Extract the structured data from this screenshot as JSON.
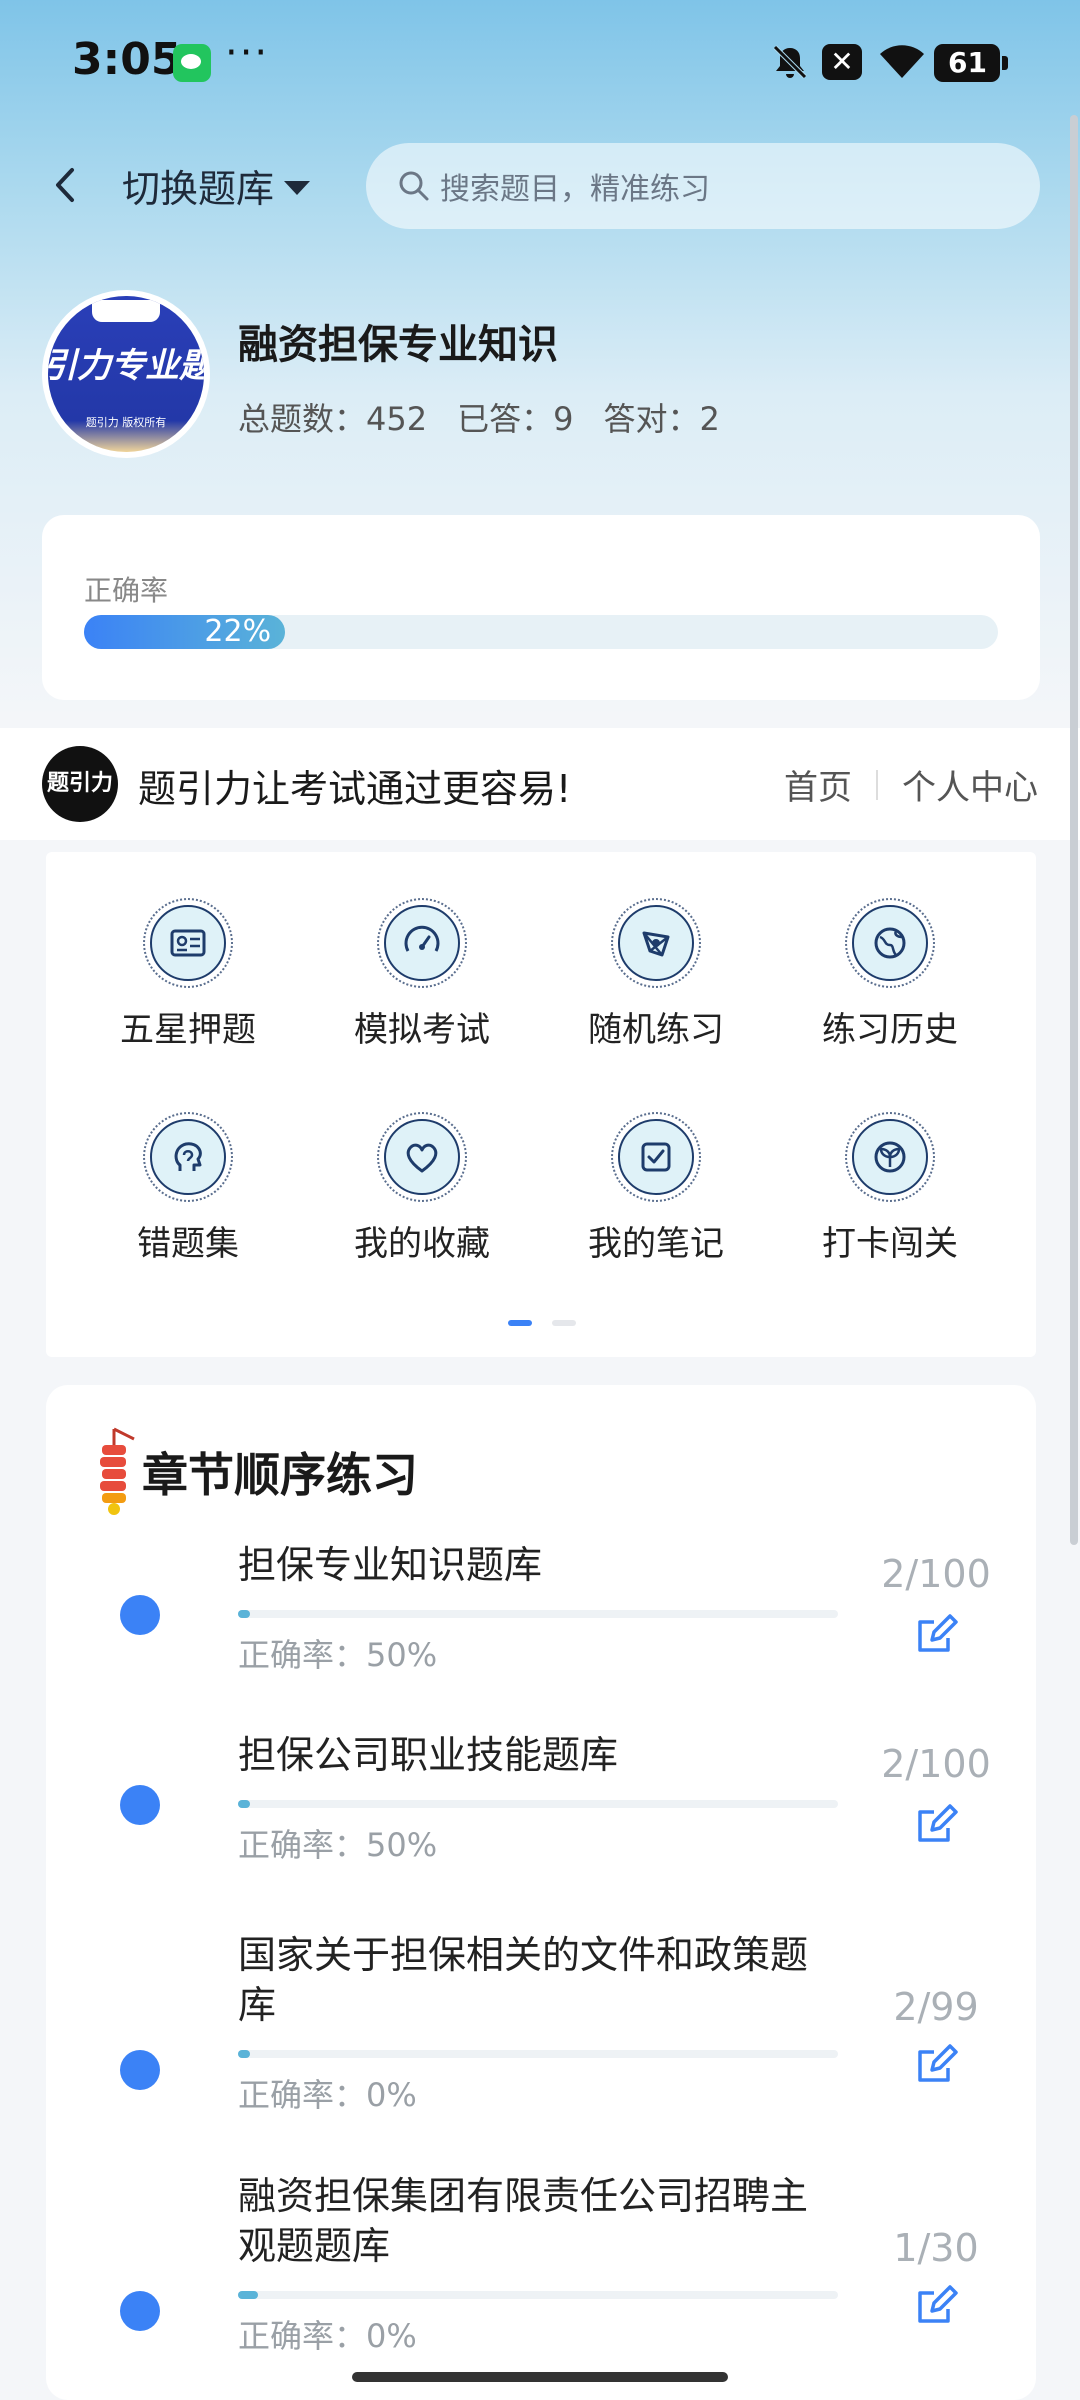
{
  "status": {
    "time": "3:05",
    "dots": "···",
    "x_label": "✕",
    "battery": "61"
  },
  "nav": {
    "switch_label": "切换题库",
    "search_placeholder": "搜索题目，精准练习"
  },
  "bank": {
    "logo_title": "引力专业题",
    "logo_sub": "题引力 版权所有",
    "name": "融资担保专业知识",
    "stats": {
      "total": "总题数：452",
      "answered": "已答：9",
      "correct": "答对：2"
    }
  },
  "accuracy": {
    "label": "正确率",
    "pct_text": "22%",
    "value": 0.22
  },
  "promo": {
    "logo_text": "题引力",
    "slogan": "题引力让考试通过更容易!",
    "home": "首页",
    "profile": "个人中心"
  },
  "grid": [
    {
      "label": "五星押题",
      "icon": "id-card-icon"
    },
    {
      "label": "模拟考试",
      "icon": "gauge-icon"
    },
    {
      "label": "随机练习",
      "icon": "network-icon"
    },
    {
      "label": "练习历史",
      "icon": "globe-icon"
    },
    {
      "label": "错题集",
      "icon": "head-icon"
    },
    {
      "label": "我的收藏",
      "icon": "heart-icon"
    },
    {
      "label": "我的笔记",
      "icon": "check-note-icon"
    },
    {
      "label": "打卡闯关",
      "icon": "sprout-icon"
    }
  ],
  "chapter": {
    "title": "章节顺序练习",
    "items": [
      {
        "line1": "担保专业知识题库",
        "line2": "",
        "accuracy": "正确率：50%",
        "count": "2/100",
        "progress": 0.02
      },
      {
        "line1": "担保公司职业技能题库",
        "line2": "",
        "accuracy": "正确率：50%",
        "count": "2/100",
        "progress": 0.02
      },
      {
        "line1": "国家关于担保相关的文件和政策题",
        "line2": "库",
        "accuracy": "正确率：0%",
        "count": "2/99",
        "progress": 0.02
      },
      {
        "line1": "融资担保集团有限责任公司招聘主",
        "line2": "观题题库",
        "accuracy": "正确率：0%",
        "count": "1/30",
        "progress": 0.033
      }
    ]
  },
  "colors": {
    "accent": "#3b82f6",
    "teal": "#5ab3d8"
  }
}
